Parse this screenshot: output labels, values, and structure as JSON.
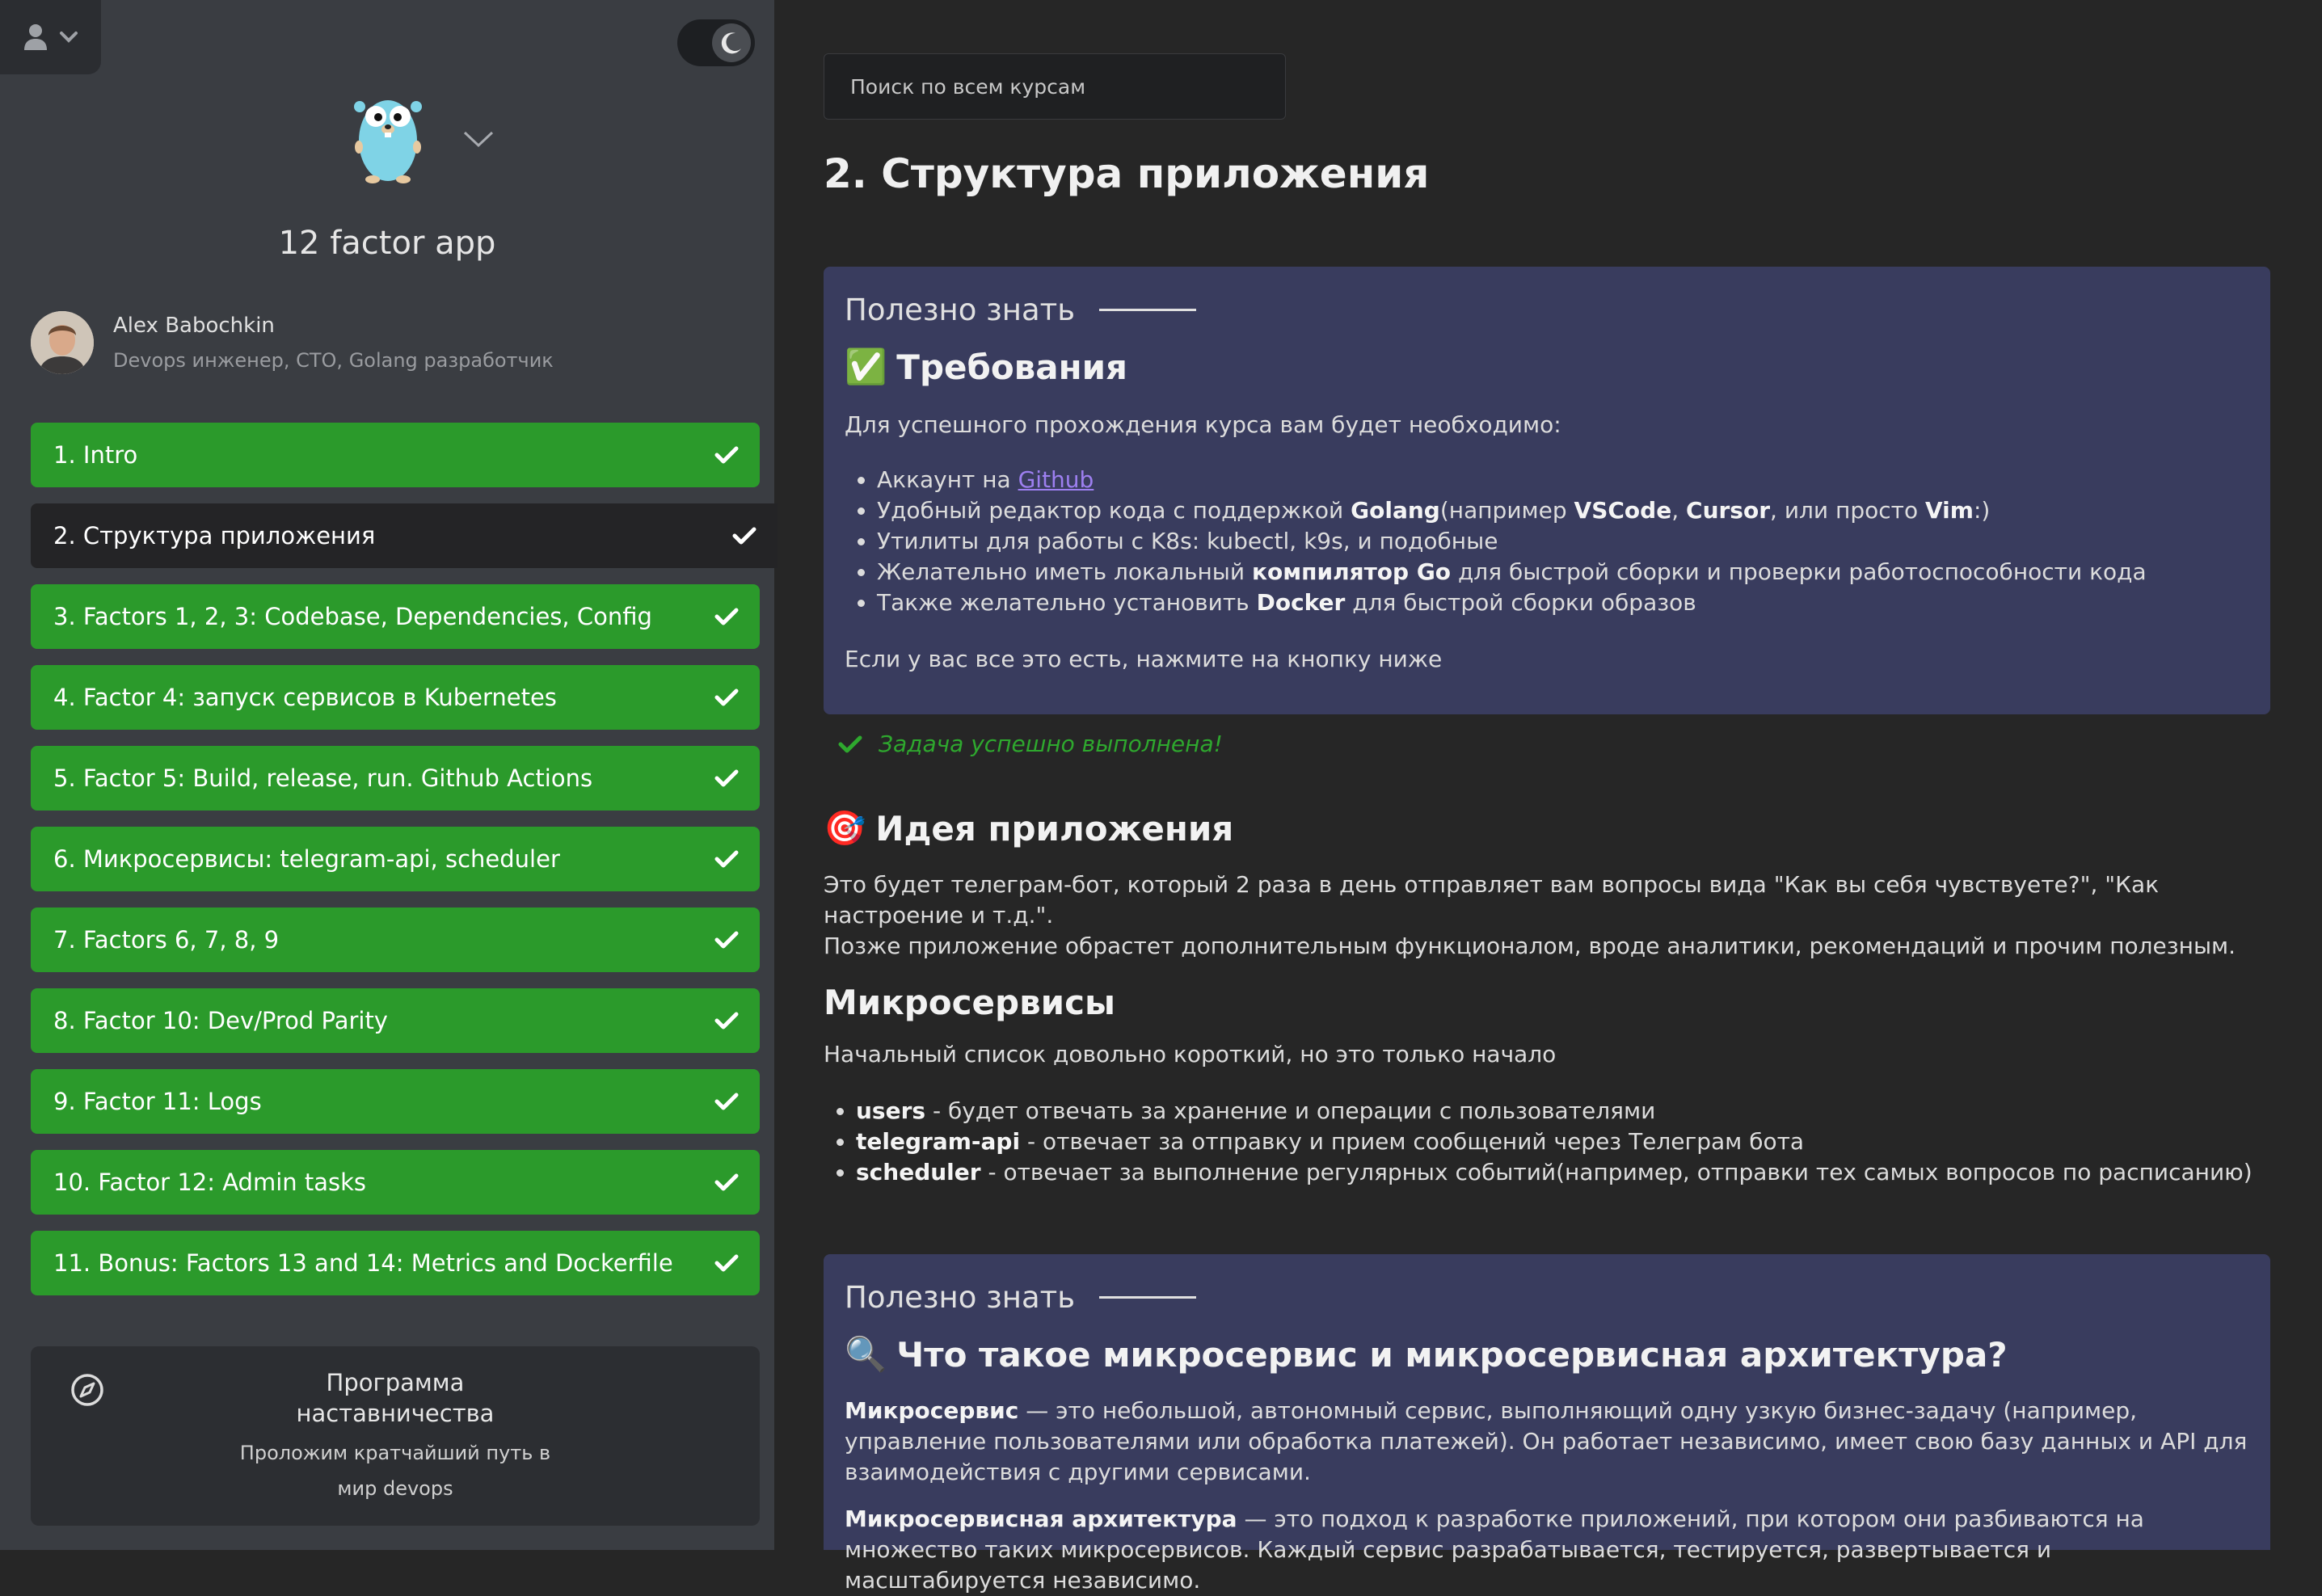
{
  "sidebar": {
    "course_title": "12 factor app",
    "author": {
      "name": "Alex Babochkin",
      "role": "Devops инженер, CTO, Golang разработчик"
    },
    "lessons": [
      {
        "label": "1. Intro",
        "done": true,
        "active": false
      },
      {
        "label": "2. Структура приложения",
        "done": true,
        "active": true
      },
      {
        "label": "3. Factors 1, 2, 3: Codebase, Dependencies, Config",
        "done": true,
        "active": false
      },
      {
        "label": "4. Factor 4: запуск сервисов в Kubernetes",
        "done": true,
        "active": false
      },
      {
        "label": "5. Factor 5: Build, release, run. Github Actions",
        "done": true,
        "active": false
      },
      {
        "label": "6. Микросервисы: telegram-api, scheduler",
        "done": true,
        "active": false
      },
      {
        "label": "7. Factors 6, 7, 8, 9",
        "done": true,
        "active": false
      },
      {
        "label": "8. Factor 10: Dev/Prod Parity",
        "done": true,
        "active": false
      },
      {
        "label": "9. Factor 11: Logs",
        "done": true,
        "active": false
      },
      {
        "label": "10. Factor 12: Admin tasks",
        "done": true,
        "active": false
      },
      {
        "label": "11. Bonus: Factors 13 and 14: Metrics and Dockerfile",
        "done": true,
        "active": false
      }
    ],
    "mentor": {
      "title": "Программа наставничества",
      "subtitle": "Проложим кратчайший путь в мир devops"
    }
  },
  "main": {
    "search_placeholder": "Поиск по всем курсам",
    "page_title": "2. Структура приложения",
    "card1": {
      "label": "Полезно знать",
      "heading_emoji": "✅",
      "heading": "Требования",
      "intro": "Для успешного прохождения курса вам будет необходимо:",
      "items": {
        "i1_pre": "Аккаунт на ",
        "i1_link": "Github",
        "i2_pre": "Удобный редактор кода с поддержкой ",
        "i2_b1": "Golang",
        "i2_mid": "(например ",
        "i2_b2": "VSCode",
        "i2_sep": ", ",
        "i2_b3": "Cursor",
        "i2_mid2": ", или просто ",
        "i2_b4": "Vim",
        "i2_end": ":)",
        "i3": "Утилиты для работы с K8s: kubectl, k9s, и подобные",
        "i4_pre": "Желательно иметь локальный ",
        "i4_b": "компилятор Go",
        "i4_post": " для быстрой сборки и проверки работоспособности кода",
        "i5_pre": "Также желательно установить ",
        "i5_b": "Docker",
        "i5_post": " для быстрой сборки образов"
      },
      "outro": "Если у вас все это есть, нажмите на кнопку ниже"
    },
    "task_done": "Задача успешно выполнена!",
    "idea": {
      "emoji": "🎯",
      "heading": "Идея приложения",
      "text1": "Это будет телеграм-бот, который 2 раза в день отправляет вам вопросы вида \"Как вы себя чувствуете?\", \"Как настроение и т.д.\".",
      "text2": "Позже приложение обрастет дополнительным функционалом, вроде аналитики, рекомендаций и прочим полезным."
    },
    "micro": {
      "heading": "Микросервисы",
      "intro": "Начальный список довольно короткий, но это только начало",
      "items": [
        {
          "name": "users",
          "desc": " - будет отвечать за хранение и операции с пользователями"
        },
        {
          "name": "telegram-api",
          "desc": " - отвечает за отправку и прием сообщений через Телеграм бота"
        },
        {
          "name": "scheduler",
          "desc": " - отвечает за выполнение регулярных событий(например, отправки тех самых вопросов по расписанию)"
        }
      ]
    },
    "card2": {
      "label": "Полезно знать",
      "heading_emoji": "🔍",
      "heading": "Что такое микросервис и микросервисная архитектура?",
      "p1_b": "Микросервис",
      "p1": " — это небольшой, автономный сервис, выполняющий одну узкую бизнес-задачу (например, управление пользователями или обработка платежей). Он работает независимо, имеет свою базу данных и API для взаимодействия с другими сервисами.",
      "p2_b": "Микросервисная архитектура",
      "p2": " — это подход к разработке приложений, при котором они разбиваются на множество таких микросервисов. Каждый сервис разрабатывается, тестируется, развертывается и масштабируется независимо."
    }
  },
  "colors": {
    "sidebar_bg": "#3a3d42",
    "main_bg": "#262626",
    "lesson_green": "#2b9a2b",
    "card_bg": "#393c5e",
    "link": "#9d7ff0",
    "success": "#2ea82e"
  },
  "icons": [
    "user-icon",
    "chevron-down-icon",
    "moon-icon",
    "gopher-logo",
    "check-icon",
    "compass-icon"
  ]
}
